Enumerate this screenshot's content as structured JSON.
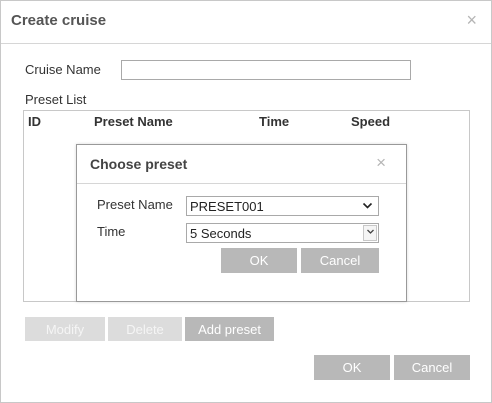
{
  "dialog": {
    "title": "Create cruise",
    "close_glyph": "×",
    "cruise_name_label": "Cruise Name",
    "cruise_name_value": "",
    "preset_list_label": "Preset List",
    "table": {
      "columns": [
        "ID",
        "Preset Name",
        "Time",
        "Speed"
      ]
    },
    "buttons": {
      "modify": "Modify",
      "delete": "Delete",
      "add_preset": "Add preset",
      "ok": "OK",
      "cancel": "Cancel"
    }
  },
  "choose_preset": {
    "title": "Choose preset",
    "close_glyph": "×",
    "preset_name_label": "Preset Name",
    "preset_name_value": "PRESET001",
    "time_label": "Time",
    "time_value": "5 Seconds",
    "ok": "OK",
    "cancel": "Cancel"
  },
  "icons": {
    "chevron_down": "chevron-down-icon",
    "spinner": "spinner-arrow-icon",
    "close": "close-icon"
  },
  "colors": {
    "disabled_button": "#dcdcdc",
    "button": "#b8b8b8",
    "border": "#c8c8c8"
  }
}
